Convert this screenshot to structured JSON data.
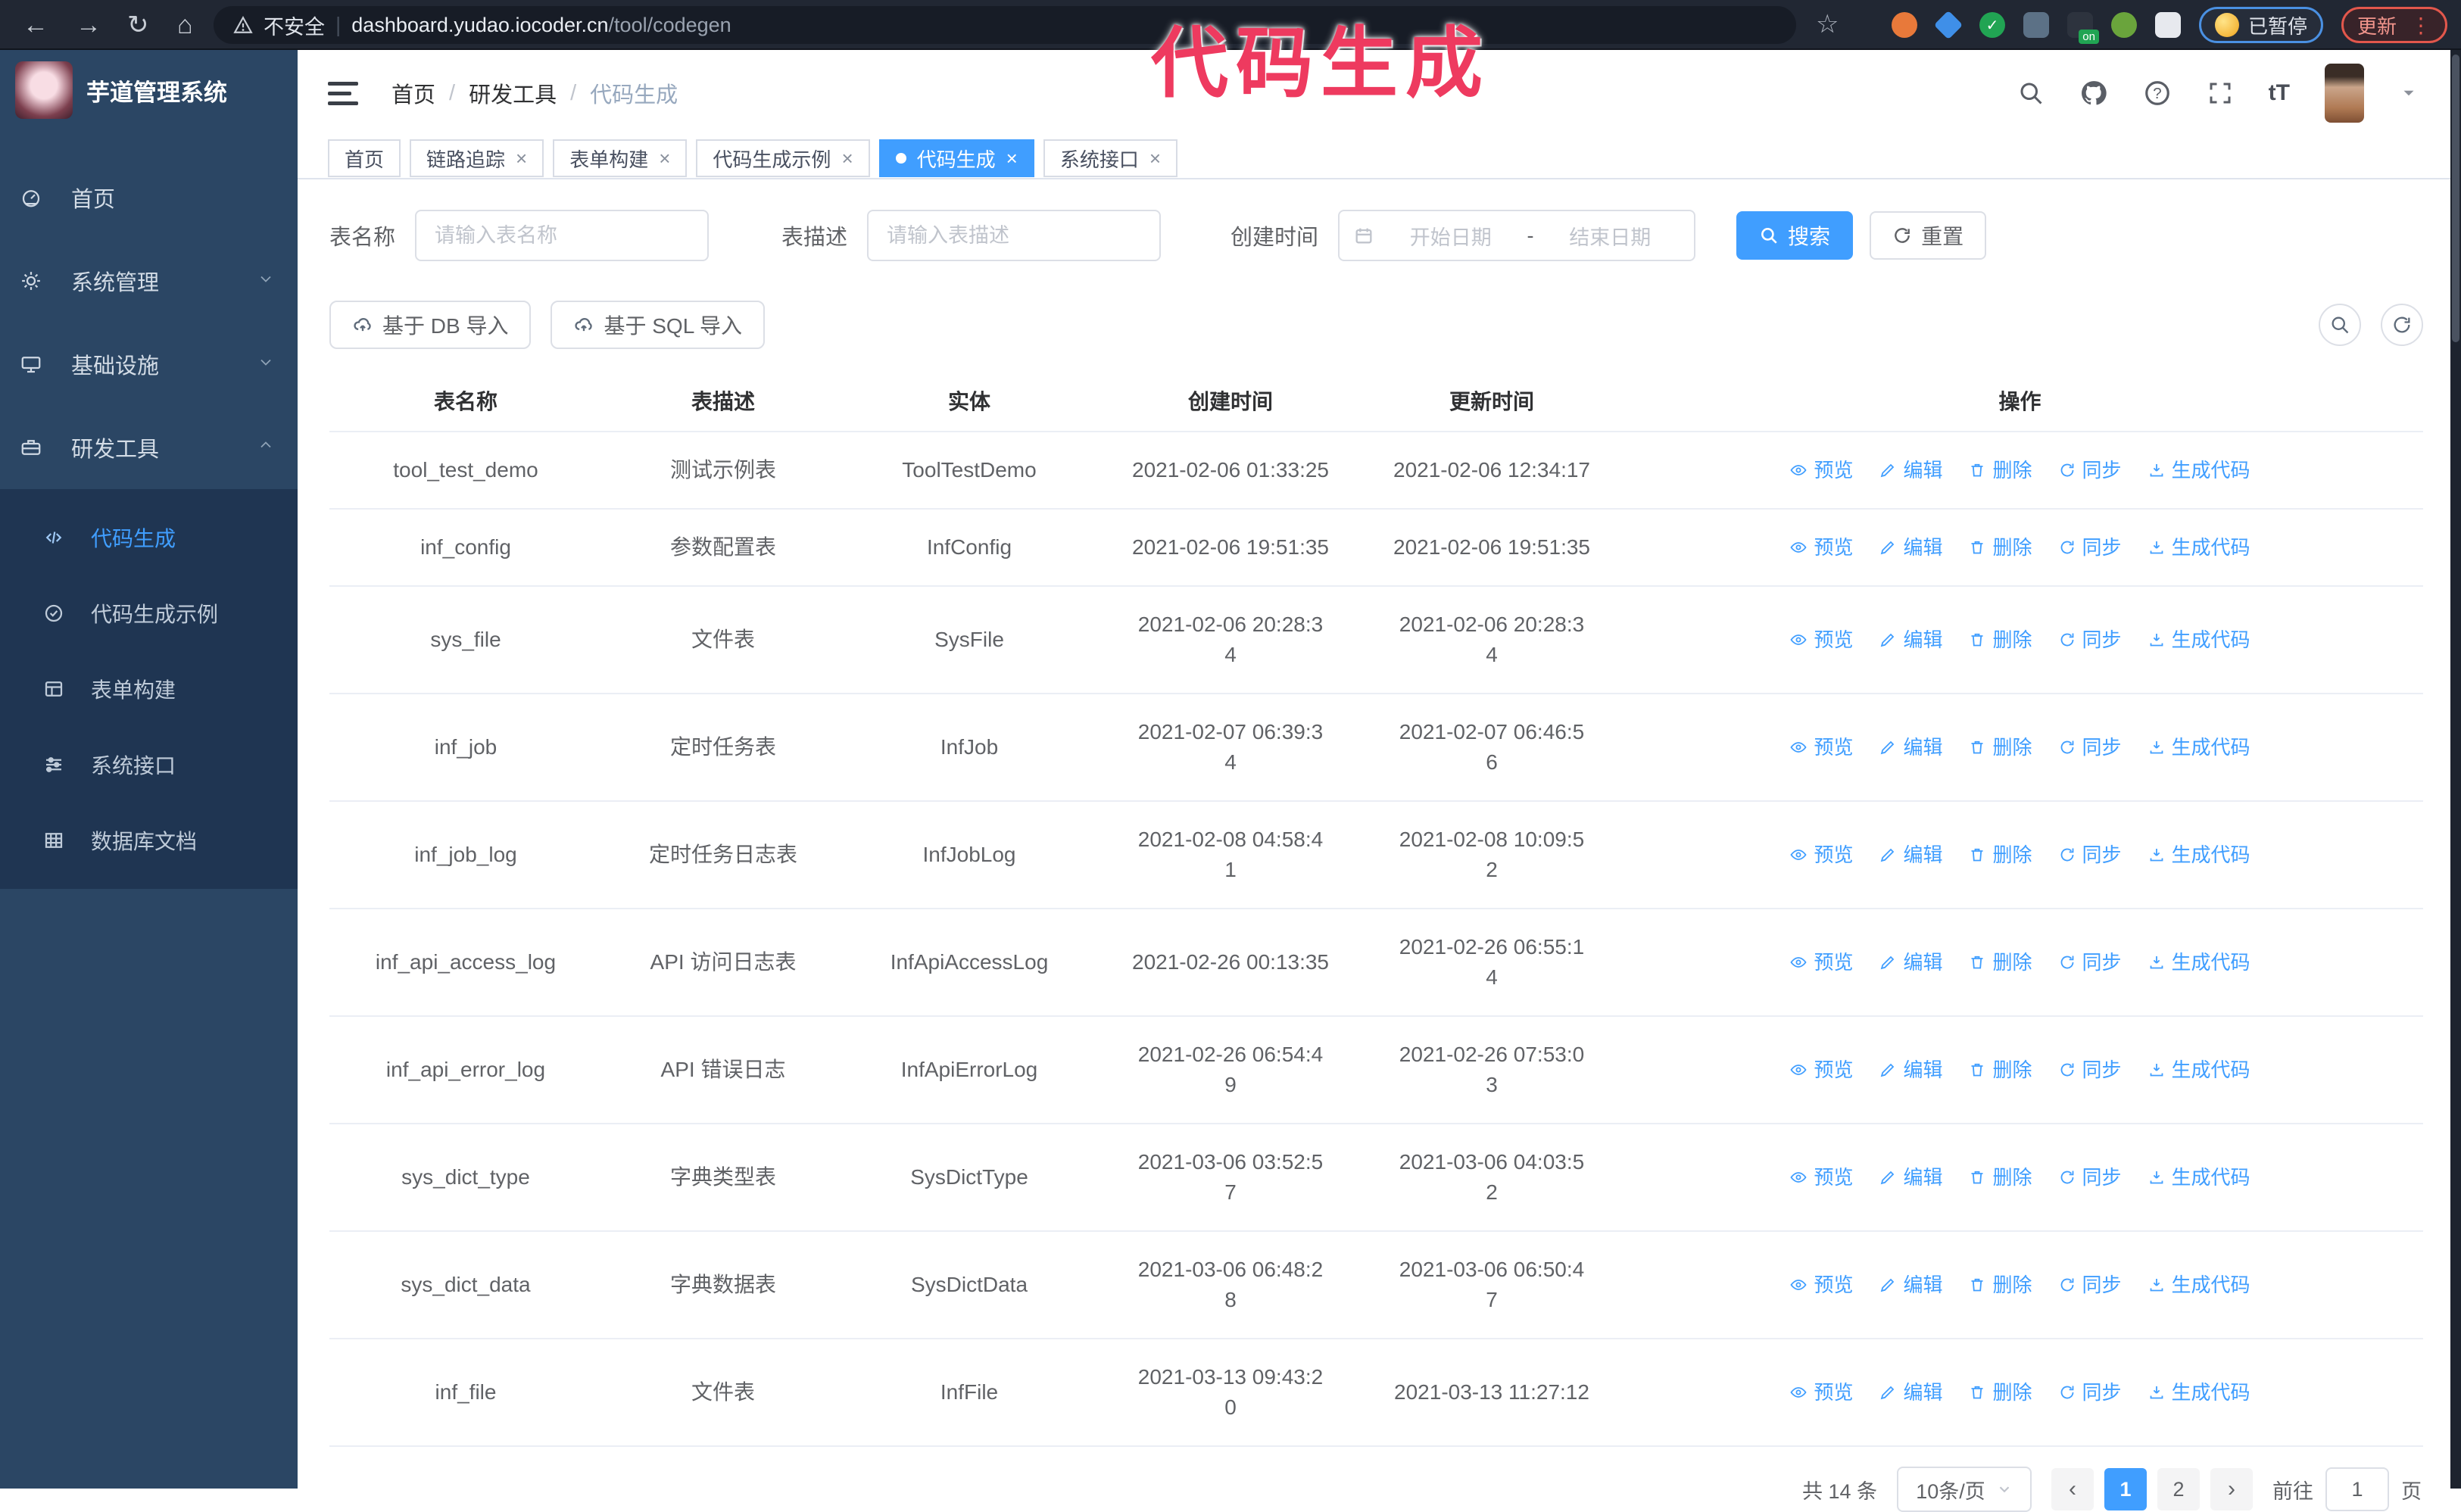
{
  "colors": {
    "accent": "#409eff",
    "watermark": "#ee3a5f",
    "sidebar_bg": "#2b4664",
    "submenu_bg": "#1f3552",
    "chrome_bg": "#212733",
    "update_border": "#e2574c",
    "paused_border": "#4a90e2"
  },
  "watermark": "代码生成",
  "browser": {
    "security_label": "不安全",
    "url_host": "dashboard.yudao.iocoder.cn",
    "url_path": "/tool/codegen",
    "profile_badge": "已暂停",
    "update_button": "更新",
    "extensions": [
      {
        "name": "extension-icon",
        "color": "#e8793a",
        "shape": "circle"
      },
      {
        "name": "extension-icon",
        "color": "#3f8fe8",
        "shape": "diamond"
      },
      {
        "name": "extension-icon",
        "color": "#21a453",
        "shape": "circle",
        "glyph": "✓"
      },
      {
        "name": "extension-icon",
        "color": "#5c7186",
        "shape": "square"
      },
      {
        "name": "extension-icon",
        "color": "#2d333e",
        "shape": "square",
        "badge": "on"
      },
      {
        "name": "extension-icon",
        "color": "#6aa43c",
        "shape": "circle"
      },
      {
        "name": "extension-icon",
        "color": "#e7e9ee",
        "shape": "square"
      }
    ]
  },
  "sidebar": {
    "title": "芋道管理系统",
    "items": [
      {
        "label": "首页",
        "icon": "dashboard-icon"
      },
      {
        "label": "系统管理",
        "icon": "gear-icon",
        "chevron": "down"
      },
      {
        "label": "基础设施",
        "icon": "monitor-icon",
        "chevron": "down"
      },
      {
        "label": "研发工具",
        "icon": "toolbox-icon",
        "chevron": "up"
      }
    ],
    "submenu": [
      {
        "label": "代码生成",
        "icon": "code-icon",
        "active": true
      },
      {
        "label": "代码生成示例",
        "icon": "badge-check-icon"
      },
      {
        "label": "表单构建",
        "icon": "form-icon"
      },
      {
        "label": "系统接口",
        "icon": "sliders-icon"
      },
      {
        "label": "数据库文档",
        "icon": "database-icon"
      }
    ]
  },
  "header": {
    "breadcrumb": [
      "首页",
      "研发工具",
      "代码生成"
    ],
    "icons": [
      "search-icon",
      "github-icon",
      "help-icon",
      "fullscreen-icon",
      "font-size-icon"
    ],
    "font_size_glyph": "tT"
  },
  "tabs": [
    {
      "label": "首页",
      "closable": false,
      "active": false
    },
    {
      "label": "链路追踪",
      "closable": true,
      "active": false
    },
    {
      "label": "表单构建",
      "closable": true,
      "active": false
    },
    {
      "label": "代码生成示例",
      "closable": true,
      "active": false
    },
    {
      "label": "代码生成",
      "closable": true,
      "active": true
    },
    {
      "label": "系统接口",
      "closable": true,
      "active": false
    }
  ],
  "search_form": {
    "table_name_label": "表名称",
    "table_name_placeholder": "请输入表名称",
    "table_desc_label": "表描述",
    "table_desc_placeholder": "请输入表描述",
    "create_time_label": "创建时间",
    "date_start_placeholder": "开始日期",
    "date_separator": "-",
    "date_end_placeholder": "结束日期",
    "search_button": "搜索",
    "reset_button": "重置"
  },
  "toolbar": {
    "import_db_button": "基于 DB 导入",
    "import_sql_button": "基于 SQL 导入"
  },
  "table": {
    "columns": [
      "表名称",
      "表描述",
      "实体",
      "创建时间",
      "更新时间",
      "操作"
    ],
    "actions": [
      {
        "name": "preview",
        "label": "预览",
        "icon": "eye-icon"
      },
      {
        "name": "edit",
        "label": "编辑",
        "icon": "pencil-icon"
      },
      {
        "name": "delete",
        "label": "删除",
        "icon": "trash-icon"
      },
      {
        "name": "sync",
        "label": "同步",
        "icon": "sync-icon"
      },
      {
        "name": "generate",
        "label": "生成代码",
        "icon": "download-icon"
      }
    ],
    "rows": [
      {
        "name": "tool_test_demo",
        "desc": "测试示例表",
        "entity": "ToolTestDemo",
        "create": "2021-02-06 01:33:25",
        "update": "2021-02-06 12:34:17"
      },
      {
        "name": "inf_config",
        "desc": "参数配置表",
        "entity": "InfConfig",
        "create": "2021-02-06 19:51:35",
        "update": "2021-02-06 19:51:35"
      },
      {
        "name": "sys_file",
        "desc": "文件表",
        "entity": "SysFile",
        "create": "2021-02-06 20:28:3\n4",
        "update": "2021-02-06 20:28:3\n4"
      },
      {
        "name": "inf_job",
        "desc": "定时任务表",
        "entity": "InfJob",
        "create": "2021-02-07 06:39:3\n4",
        "update": "2021-02-07 06:46:5\n6"
      },
      {
        "name": "inf_job_log",
        "desc": "定时任务日志表",
        "entity": "InfJobLog",
        "create": "2021-02-08 04:58:4\n1",
        "update": "2021-02-08 10:09:5\n2"
      },
      {
        "name": "inf_api_access_log",
        "desc": "API 访问日志表",
        "entity": "InfApiAccessLog",
        "create": "2021-02-26 00:13:35",
        "update": "2021-02-26 06:55:1\n4"
      },
      {
        "name": "inf_api_error_log",
        "desc": "API 错误日志",
        "entity": "InfApiErrorLog",
        "create": "2021-02-26 06:54:4\n9",
        "update": "2021-02-26 07:53:0\n3"
      },
      {
        "name": "sys_dict_type",
        "desc": "字典类型表",
        "entity": "SysDictType",
        "create": "2021-03-06 03:52:5\n7",
        "update": "2021-03-06 04:03:5\n2"
      },
      {
        "name": "sys_dict_data",
        "desc": "字典数据表",
        "entity": "SysDictData",
        "create": "2021-03-06 06:48:2\n8",
        "update": "2021-03-06 06:50:4\n7"
      },
      {
        "name": "inf_file",
        "desc": "文件表",
        "entity": "InfFile",
        "create": "2021-03-13 09:43:2\n0",
        "update": "2021-03-13 11:27:12"
      }
    ]
  },
  "pagination": {
    "total": "共 14 条",
    "page_size": "10条/页",
    "pages": [
      "1",
      "2"
    ],
    "active_page": "1",
    "goto_label": "前往",
    "goto_value": "1",
    "goto_suffix": "页"
  }
}
